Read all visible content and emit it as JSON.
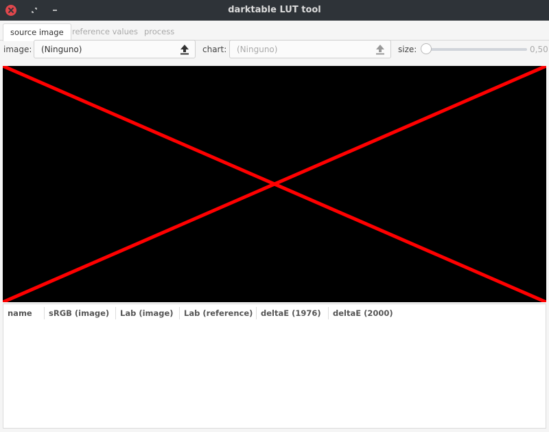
{
  "window": {
    "title": "darktable LUT tool"
  },
  "tabs": [
    {
      "label": "source image",
      "active": true
    },
    {
      "label": "reference values",
      "active": false
    },
    {
      "label": "process",
      "active": false
    }
  ],
  "controls": {
    "image_label": "image:",
    "image_value": "(Ninguno)",
    "chart_label": "chart:",
    "chart_value": "(Ninguno)",
    "size_label": "size:",
    "size_value": "0,50"
  },
  "table": {
    "columns": [
      "name",
      "sRGB (image)",
      "Lab (image)",
      "Lab (reference)",
      "deltaE (1976)",
      "deltaE (2000)"
    ],
    "rows": []
  },
  "colors": {
    "titlebar": "#2e3338",
    "close_button": "#e0474c",
    "canvas_background": "#000000",
    "cross_lines": "#ff0000"
  },
  "icons": {
    "close": "close-icon",
    "maximize": "maximize-icon",
    "minimize": "minimize-icon",
    "upload": "upload-icon"
  }
}
